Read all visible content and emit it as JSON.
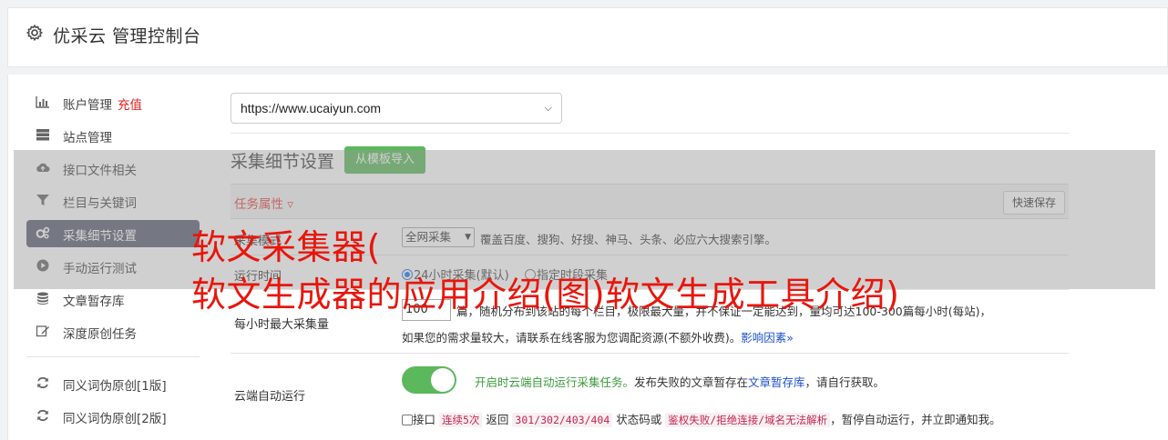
{
  "header": {
    "title": "优采云 管理控制台",
    "icon": "gear-icon"
  },
  "sidebar": {
    "items": [
      {
        "label": "账户管理",
        "extra": "充值",
        "icon": "bar-chart-icon"
      },
      {
        "label": "站点管理",
        "icon": "server-icon"
      },
      {
        "label": "接口文件相关",
        "icon": "cloud-upload-icon"
      },
      {
        "label": "栏目与关键词",
        "icon": "filter-icon"
      },
      {
        "label": "采集细节设置",
        "icon": "gears-icon",
        "active": true
      },
      {
        "label": "手动运行测试",
        "icon": "play-circle-icon"
      },
      {
        "label": "文章暂存库",
        "icon": "database-icon"
      },
      {
        "label": "深度原创任务",
        "icon": "edit-icon"
      }
    ],
    "items2": [
      {
        "label": "同义词伪原创[1版]",
        "icon": "refresh-icon"
      },
      {
        "label": "同义词伪原创[2版]",
        "icon": "refresh-icon"
      }
    ]
  },
  "main": {
    "site_select": "https://www.ucaiyun.com",
    "section_title": "采集细节设置",
    "import_button": "从模板导入",
    "tab_label": "任务属性 ▿",
    "save_button": "快速保存",
    "rows": {
      "mode": {
        "label": "采集模式",
        "select": "全网采集",
        "desc": "覆盖百度、搜狗、好搜、神马、头条、必应六大搜索引擎。"
      },
      "time": {
        "label": "运行时间",
        "opt1": "24小时采集(默认)",
        "opt2": "指定时段采集"
      },
      "max": {
        "label": "每小时最大采集量",
        "value": "100",
        "line1": "篇，随机分布到该站的每个栏目，极限最大量，并不保证一定能达到，量均可达100-300篇每小时(每站)，",
        "line2": "如果您的需求量较大，请联系在线客服为您调配资源(不额外收费)。",
        "link": "影响因素»"
      },
      "cloud": {
        "label": "云端自动运行",
        "tip_green": "开启时云端自动运行采集任务。",
        "tip_mid": "发布失败的文章暂存在",
        "tip_link": "文章暂存库",
        "tip_end": "，请自行获取。",
        "line_a": "接口",
        "code1": "连续5次",
        "line_b": "返回",
        "code2": "301/302/403/404",
        "line_c": "状态码或",
        "code3": "鉴权失败/拒绝连接/域名无法解析",
        "line_d": "，暂停自动运行，并立即通知我。"
      }
    }
  },
  "watermark": {
    "line1": "软文采集器(",
    "line2": "软文生成器的应用介绍(图)软文生成工具介绍)"
  },
  "colors": {
    "accent_green": "#5cb85c",
    "active_nav": "#5a6072",
    "watermark_red": "#e8160c"
  }
}
